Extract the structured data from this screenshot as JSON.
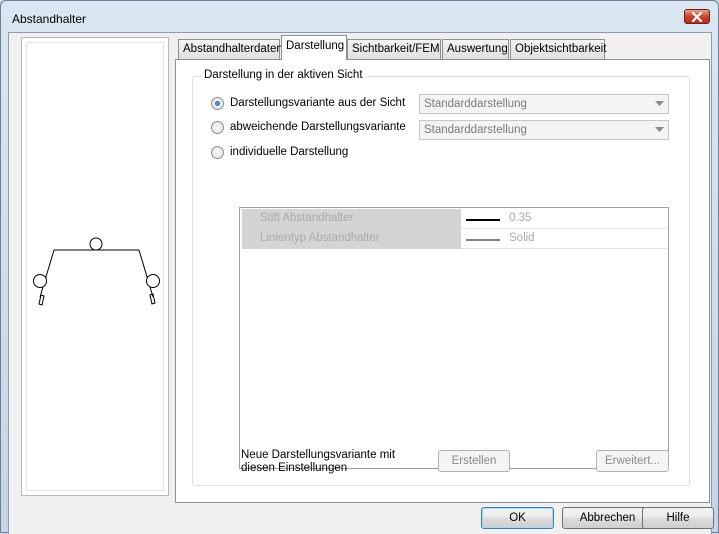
{
  "window": {
    "title": "Abstandhalter"
  },
  "tabs": [
    {
      "label": "Abstandhalterdaten"
    },
    {
      "label": "Darstellung"
    },
    {
      "label": "Sichtbarkeit/FEM"
    },
    {
      "label": "Auswertung"
    },
    {
      "label": "Objektsichtbarkeit"
    }
  ],
  "active_tab": "Darstellung",
  "group": {
    "title": "Darstellung in der aktiven Sicht"
  },
  "options": [
    {
      "label": "Darstellungsvariante aus der Sicht",
      "checked": true,
      "dropdown": "Standarddarstellung"
    },
    {
      "label": "abweichende Darstellungsvariante",
      "checked": false,
      "dropdown": "Standarddarstellung"
    },
    {
      "label": "individuelle Darstellung",
      "checked": false
    }
  ],
  "properties": [
    {
      "name": "Stift Abstandhalter",
      "value": "0.35",
      "line_style": "thick-solid"
    },
    {
      "name": "Linientyp Abstandhalter",
      "value": "Solid",
      "line_style": "thin-solid"
    }
  ],
  "footer": {
    "text": "Neue Darstellungsvariante mit diesen Einstellungen",
    "create_label": "Erstellen",
    "extended_label": "Erweitert..."
  },
  "buttons": {
    "ok": "OK",
    "cancel": "Abbrechen",
    "help": "Hilfe"
  },
  "colors": {
    "accent": "#3c7fb1",
    "disabled_text": "#a9a9a9",
    "close_button": "#c9452f"
  }
}
